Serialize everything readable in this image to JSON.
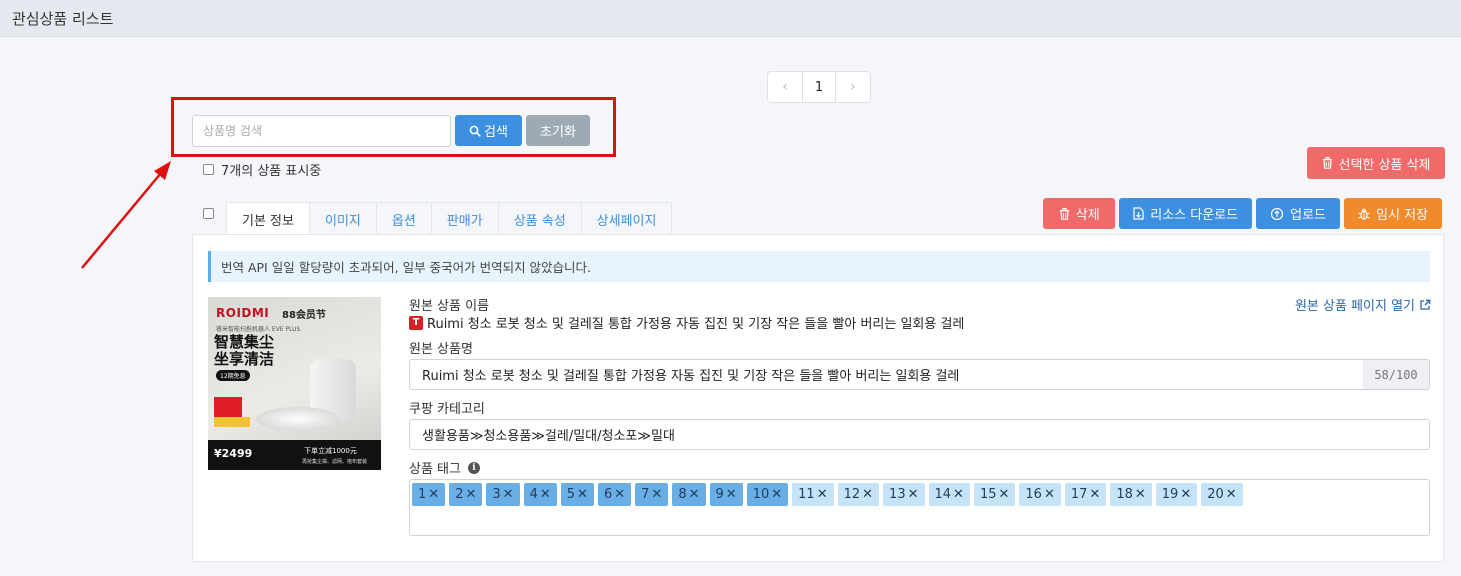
{
  "header": {
    "title": "관심상품 리스트"
  },
  "pagination": {
    "prev": "‹",
    "current": "1",
    "next": "›"
  },
  "search": {
    "placeholder": "상품명 검색",
    "value": "",
    "search_label": "검색",
    "reset_label": "초기화"
  },
  "list": {
    "count_text": "7개의 상품 표시중"
  },
  "delete_selected_label": "선택한 상품 삭제",
  "tabs": [
    {
      "label": "기본 정보",
      "active": true
    },
    {
      "label": "이미지"
    },
    {
      "label": "옵션"
    },
    {
      "label": "판매가"
    },
    {
      "label": "상품 속성"
    },
    {
      "label": "상세페이지"
    }
  ],
  "actions": {
    "delete": "삭제",
    "download": "리소스 다운로드",
    "upload": "업로드",
    "temp_save": "임시 저장"
  },
  "notice": "번역 API 일일 할당량이 초과되어, 일부 중국어가 번역되지 않았습니다.",
  "product": {
    "image": {
      "brand": "ROIDMI",
      "brand_sub": "88会员节",
      "model": "睿米智能扫拖机器人 EVE PLUS",
      "headline_line1": "智慧集尘",
      "headline_line2": "坐享清洁",
      "tag": "12期免息",
      "price": "¥2499",
      "promo": "下单立减1000元",
      "promo_sub": "再抢集尘袋、滤网、拖布套装"
    },
    "orig_name_label": "원본 상품 이름",
    "open_link_label": "원본 상품 페이지 열기",
    "source_badge": "T",
    "orig_name": "Ruimi 청소 로봇 청소 및 걸레질 통합 가정용 자동 집진 및 기장 작은 들을 빨아 버리는 일회용 걸레",
    "name_label": "원본 상품명",
    "name_value": "Ruimi 청소 로봇 청소 및 걸레질 통합 가정용 자동 집진 및 기장 작은 들을 빨아 버리는 일회용 걸레",
    "name_counter": "58/100",
    "category_label": "쿠팡 카테고리",
    "category_value": "생활용품≫청소용품≫걸레/밀대/청소포≫밀대",
    "tags_label": "상품 태그",
    "tags": [
      {
        "label": "1",
        "selected": true
      },
      {
        "label": "2",
        "selected": true
      },
      {
        "label": "3",
        "selected": true
      },
      {
        "label": "4",
        "selected": true
      },
      {
        "label": "5",
        "selected": true
      },
      {
        "label": "6",
        "selected": true
      },
      {
        "label": "7",
        "selected": true
      },
      {
        "label": "8",
        "selected": true
      },
      {
        "label": "9",
        "selected": true
      },
      {
        "label": "10",
        "selected": true
      },
      {
        "label": "11",
        "selected": false
      },
      {
        "label": "12",
        "selected": false
      },
      {
        "label": "13",
        "selected": false
      },
      {
        "label": "14",
        "selected": false
      },
      {
        "label": "15",
        "selected": false
      },
      {
        "label": "16",
        "selected": false
      },
      {
        "label": "17",
        "selected": false
      },
      {
        "label": "18",
        "selected": false
      },
      {
        "label": "19",
        "selected": false
      },
      {
        "label": "20",
        "selected": false
      }
    ]
  },
  "icons": {
    "search": "magnifier-icon",
    "trash": "trash-icon",
    "download": "file-download-icon",
    "upload": "cloud-upload-icon",
    "save": "bug-icon",
    "external": "external-link-icon",
    "info": "info-icon"
  },
  "colors": {
    "primary": "#3d8fe0",
    "danger": "#f06a6a",
    "warning": "#f18a2b",
    "annotation": "#e01010",
    "tag_selected": "#6aaee6",
    "tag_plain": "#c6e3f7"
  }
}
